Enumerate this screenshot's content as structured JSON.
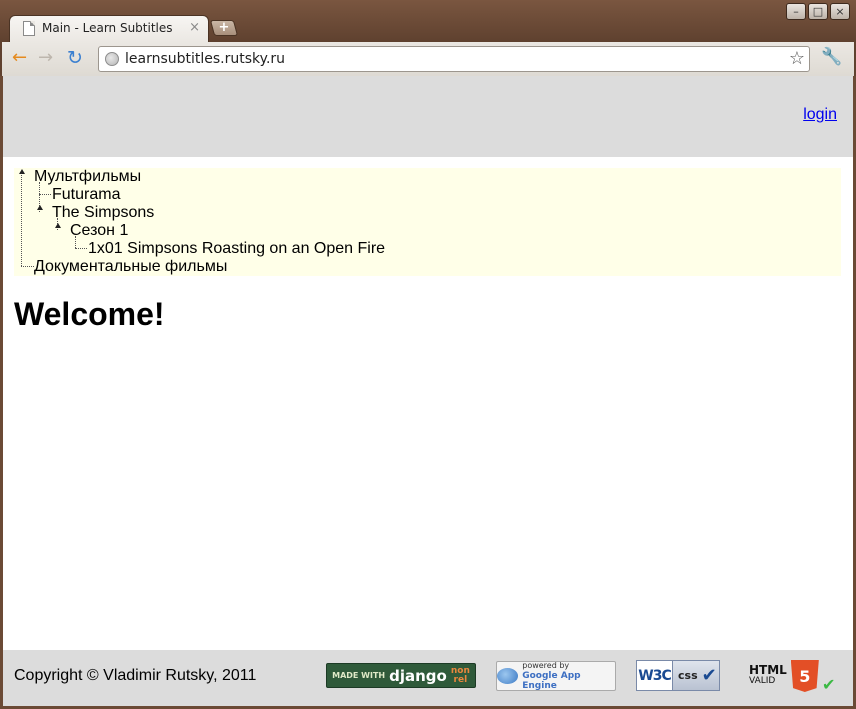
{
  "browser": {
    "tab_title": "Main - Learn Subtitles",
    "tab_close_glyph": "×",
    "new_tab_glyph": "+",
    "url": "learnsubtitles.rutsky.ru",
    "window_buttons": [
      "–",
      "□",
      "×"
    ],
    "icons": {
      "back": "←",
      "forward": "→",
      "reload": "↻",
      "bookmark_star": "☆",
      "wrench": "🔧"
    }
  },
  "page": {
    "header": {
      "login_label": "login"
    },
    "tree": {
      "items": [
        {
          "label": "Мультфильмы",
          "level": 0,
          "expanded": true
        },
        {
          "label": "Futurama",
          "level": 1,
          "expanded": false
        },
        {
          "label": "The Simpsons",
          "level": 1,
          "expanded": true
        },
        {
          "label": "Сезон 1",
          "level": 2,
          "expanded": true
        },
        {
          "label": "1x01 Simpsons Roasting on an Open Fire",
          "level": 3,
          "expanded": false
        },
        {
          "label": "Документальные фильмы",
          "level": 0,
          "expanded": false
        }
      ]
    },
    "heading": "Welcome!",
    "footer": {
      "copyright": "Copyright © Vladimir Rutsky, 2011",
      "badges": {
        "django_made_with": "MADE WITH",
        "django_name": "django",
        "django_nonrel_1": "non",
        "django_nonrel_2": "rel",
        "gae_powered": "powered by",
        "gae_name": "Google App Engine",
        "w3c_logo": "W3C",
        "w3c_css": "css",
        "w3c_check": "✔",
        "html5_html": "HTML",
        "html5_valid": "VALID",
        "html5_number": "5",
        "html5_check": "✔"
      }
    }
  },
  "colors": {
    "frame": "#6b4a35",
    "header_bg": "#dcdcdc",
    "tree_bg": "#ffffe8",
    "link": "#0000ee"
  }
}
